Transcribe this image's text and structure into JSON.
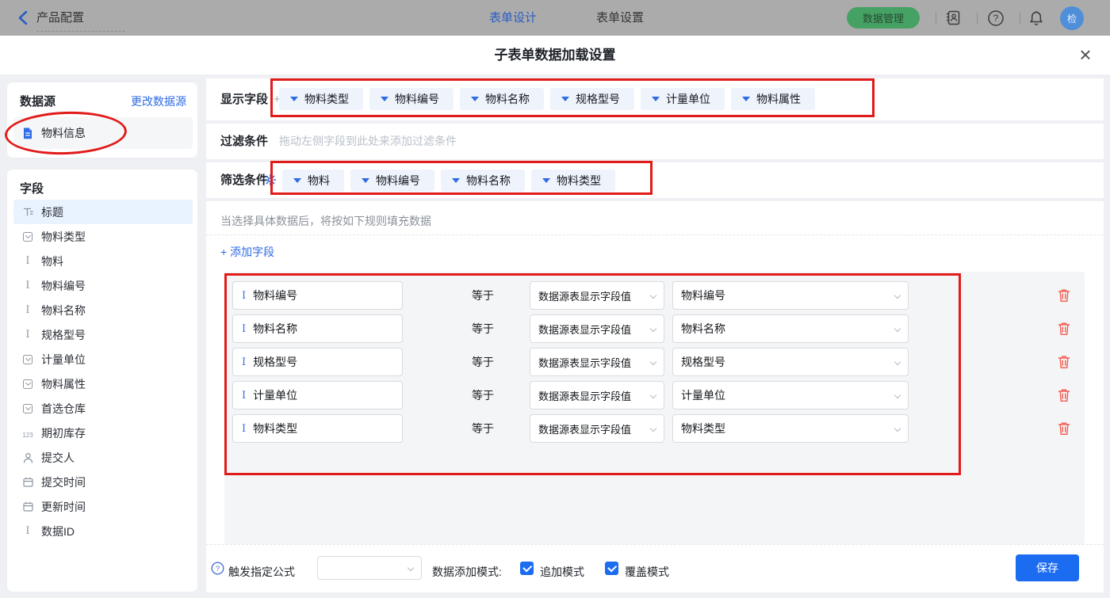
{
  "topbar": {
    "back_label": "产品配置",
    "tabs": [
      {
        "label": "表单设计"
      },
      {
        "label": "表单设置"
      }
    ],
    "data_manage_label": "数据管理",
    "avatar_text": "检"
  },
  "modal": {
    "title": "子表单数据加载设置"
  },
  "sidebar": {
    "datasource": {
      "title": "数据源",
      "change_link": "更改数据源",
      "item_label": "物料信息"
    },
    "fields": {
      "title": "字段",
      "items": [
        {
          "label": "标题",
          "icon": "title-icon"
        },
        {
          "label": "物料类型",
          "icon": "select-icon"
        },
        {
          "label": "物料",
          "icon": "text-icon"
        },
        {
          "label": "物料编号",
          "icon": "text-icon"
        },
        {
          "label": "物料名称",
          "icon": "text-icon"
        },
        {
          "label": "规格型号",
          "icon": "text-icon"
        },
        {
          "label": "计量单位",
          "icon": "select-icon"
        },
        {
          "label": "物料属性",
          "icon": "select-icon"
        },
        {
          "label": "首选仓库",
          "icon": "select-icon"
        },
        {
          "label": "期初库存",
          "icon": "number-icon",
          "icon_text": "123"
        },
        {
          "label": "提交人",
          "icon": "person-icon"
        },
        {
          "label": "提交时间",
          "icon": "calendar-icon"
        },
        {
          "label": "更新时间",
          "icon": "calendar-icon"
        },
        {
          "label": "数据ID",
          "icon": "text-icon"
        }
      ]
    }
  },
  "main": {
    "display_fields": {
      "label": "显示字段",
      "add_icon": "+",
      "tags": [
        "物料类型",
        "物料编号",
        "物料名称",
        "规格型号",
        "计量单位",
        "物料属性"
      ]
    },
    "filter": {
      "label": "过滤条件",
      "placeholder": "拖动左侧字段到此处来添加过滤条件"
    },
    "screening": {
      "label": "筛选条件",
      "tags": [
        "物料",
        "物料编号",
        "物料名称",
        "物料类型"
      ]
    },
    "rules": {
      "hint": "当选择具体数据后，将按如下规则填充数据",
      "add_field_label": "+ 添加字段",
      "operator": "等于",
      "source_option": "数据源表显示字段值",
      "rows": [
        {
          "field": "物料编号",
          "target": "物料编号"
        },
        {
          "field": "物料名称",
          "target": "物料名称"
        },
        {
          "field": "规格型号",
          "target": "规格型号"
        },
        {
          "field": "计量单位",
          "target": "计量单位"
        },
        {
          "field": "物料类型",
          "target": "物料类型"
        }
      ]
    }
  },
  "footer": {
    "formula_label": "触发指定公式",
    "mode_label": "数据添加模式:",
    "modes": [
      "追加模式",
      "覆盖模式"
    ],
    "save_label": "保存"
  },
  "colors": {
    "accent_blue": "#1c6cf2",
    "annotation_red": "#e11b19",
    "topbar_green": "#46a164",
    "danger_red": "#f35b4f"
  }
}
